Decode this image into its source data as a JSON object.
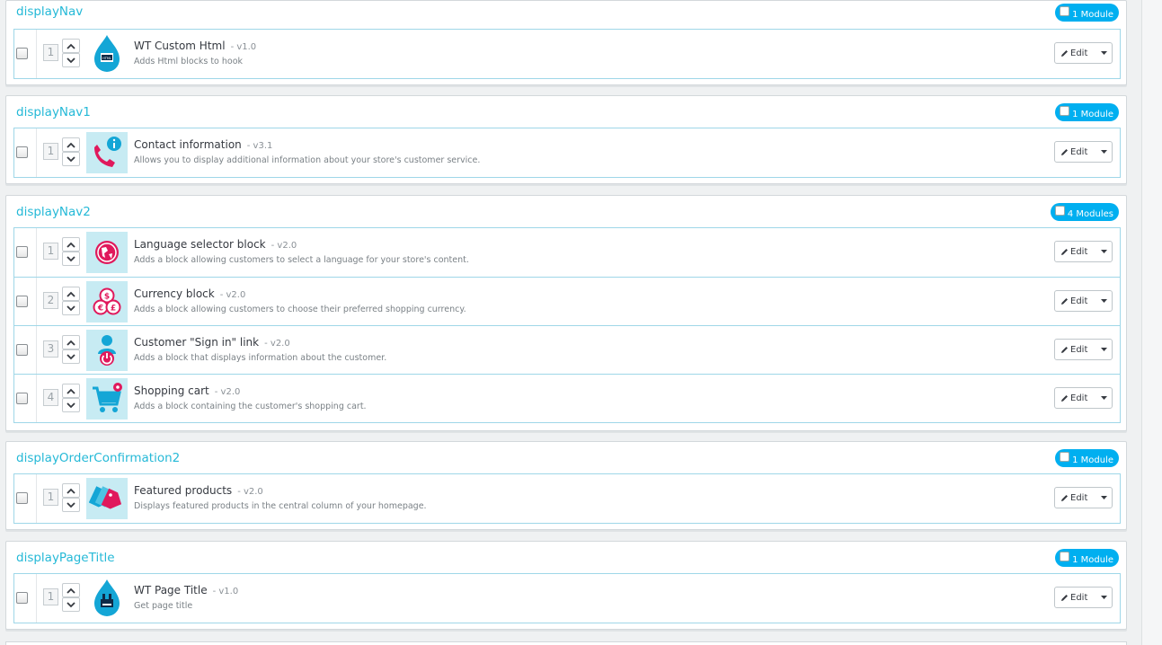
{
  "hooks": [
    {
      "title": "displayNav",
      "badge": "1 Module",
      "modules": [
        {
          "pos": "1",
          "name": "WT Custom Html",
          "version": "- v1.0",
          "desc": "Adds Html blocks to hook",
          "icon": "html-drop-icon",
          "edit": "Edit"
        }
      ]
    },
    {
      "title": "displayNav1",
      "badge": "1 Module",
      "modules": [
        {
          "pos": "1",
          "name": "Contact information",
          "version": "- v3.1",
          "desc": "Allows you to display additional information about your store's customer service.",
          "icon": "phone-info-icon",
          "edit": "Edit"
        }
      ]
    },
    {
      "title": "displayNav2",
      "badge": "4 Modules",
      "modules": [
        {
          "pos": "1",
          "name": "Language selector block",
          "version": "- v2.0",
          "desc": "Adds a block allowing customers to select a language for your store's content.",
          "icon": "globe-icon",
          "edit": "Edit"
        },
        {
          "pos": "2",
          "name": "Currency block",
          "version": "- v2.0",
          "desc": "Adds a block allowing customers to choose their preferred shopping currency.",
          "icon": "currency-icon",
          "edit": "Edit"
        },
        {
          "pos": "3",
          "name": "Customer \"Sign in\" link",
          "version": "- v2.0",
          "desc": "Adds a block that displays information about the customer.",
          "icon": "user-signin-icon",
          "edit": "Edit"
        },
        {
          "pos": "4",
          "name": "Shopping cart",
          "version": "- v2.0",
          "desc": "Adds a block containing the customer's shopping cart.",
          "icon": "cart-icon",
          "edit": "Edit"
        }
      ]
    },
    {
      "title": "displayOrderConfirmation2",
      "badge": "1 Module",
      "modules": [
        {
          "pos": "1",
          "name": "Featured products",
          "version": "- v2.0",
          "desc": "Displays featured products in the central column of your homepage.",
          "icon": "price-tags-icon",
          "edit": "Edit"
        }
      ]
    },
    {
      "title": "displayPageTitle",
      "badge": "1 Module",
      "modules": [
        {
          "pos": "1",
          "name": "WT Page Title",
          "version": "- v1.0",
          "desc": "Get page title",
          "icon": "page-title-drop-icon",
          "edit": "Edit"
        }
      ]
    }
  ],
  "colors": {
    "accent": "#25b9d7",
    "badge": "#00aff0",
    "icon_bg": "#c7ebf3",
    "icon_pink": "#e0195c"
  }
}
